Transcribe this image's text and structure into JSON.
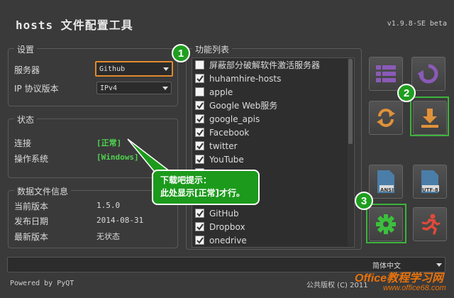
{
  "app": {
    "title": "hosts 文件配置工具",
    "version": "v1.9.8-SE beta"
  },
  "settings": {
    "group_title": "设置",
    "server_label": "服务器",
    "server_value": "Github",
    "ip_label": "IP 协议版本",
    "ip_value": "IPv4"
  },
  "status": {
    "group_title": "状态",
    "connection_label": "连接",
    "connection_value": "[正常]",
    "os_label": "操作系统",
    "os_value": "[Windows]"
  },
  "datafile": {
    "group_title": "数据文件信息",
    "current_label": "当前版本",
    "current_value": "1.5.0",
    "release_label": "发布日期",
    "release_value": "2014-08-31",
    "latest_label": "最新版本",
    "latest_value": "无状态"
  },
  "functions": {
    "group_title": "功能列表",
    "items": [
      {
        "label": "屏蔽部分破解软件激活服务器",
        "checked": false
      },
      {
        "label": "huhamhire-hosts",
        "checked": true
      },
      {
        "label": "apple",
        "checked": false
      },
      {
        "label": "Google Web服务",
        "checked": true
      },
      {
        "label": "google_apis",
        "checked": true
      },
      {
        "label": "Facebook",
        "checked": true
      },
      {
        "label": "twitter",
        "checked": true
      },
      {
        "label": "YouTube",
        "checked": true
      },
      {
        "label": "",
        "checked": true
      },
      {
        "label": "台",
        "checked": true
      },
      {
        "label": "",
        "checked": true
      },
      {
        "label": "GitHub",
        "checked": true
      },
      {
        "label": "Dropbox",
        "checked": true
      },
      {
        "label": "onedrive",
        "checked": true
      }
    ]
  },
  "tooltip": {
    "line1": "下载吧提示：",
    "line2": "此处显示[正常]才行。"
  },
  "badges": {
    "b1": "1",
    "b2": "2",
    "b3": "3"
  },
  "buttons": {
    "ansi_label": "ANSI",
    "utf8_label": "UTF-8"
  },
  "footer": {
    "powered": "Powered by PyQT",
    "copyright": "公共版权 (C) 2011",
    "language": "简体中文"
  },
  "watermark": {
    "line1": "Office教程学习网",
    "line2": "www.office68.com"
  },
  "colors": {
    "accent_green": "#1f9e1f",
    "status_green": "#4fd14f",
    "focus_orange": "#e08a2c",
    "purple": "#8a5ab8",
    "orange": "#e0923a",
    "red": "#e04a3a"
  }
}
